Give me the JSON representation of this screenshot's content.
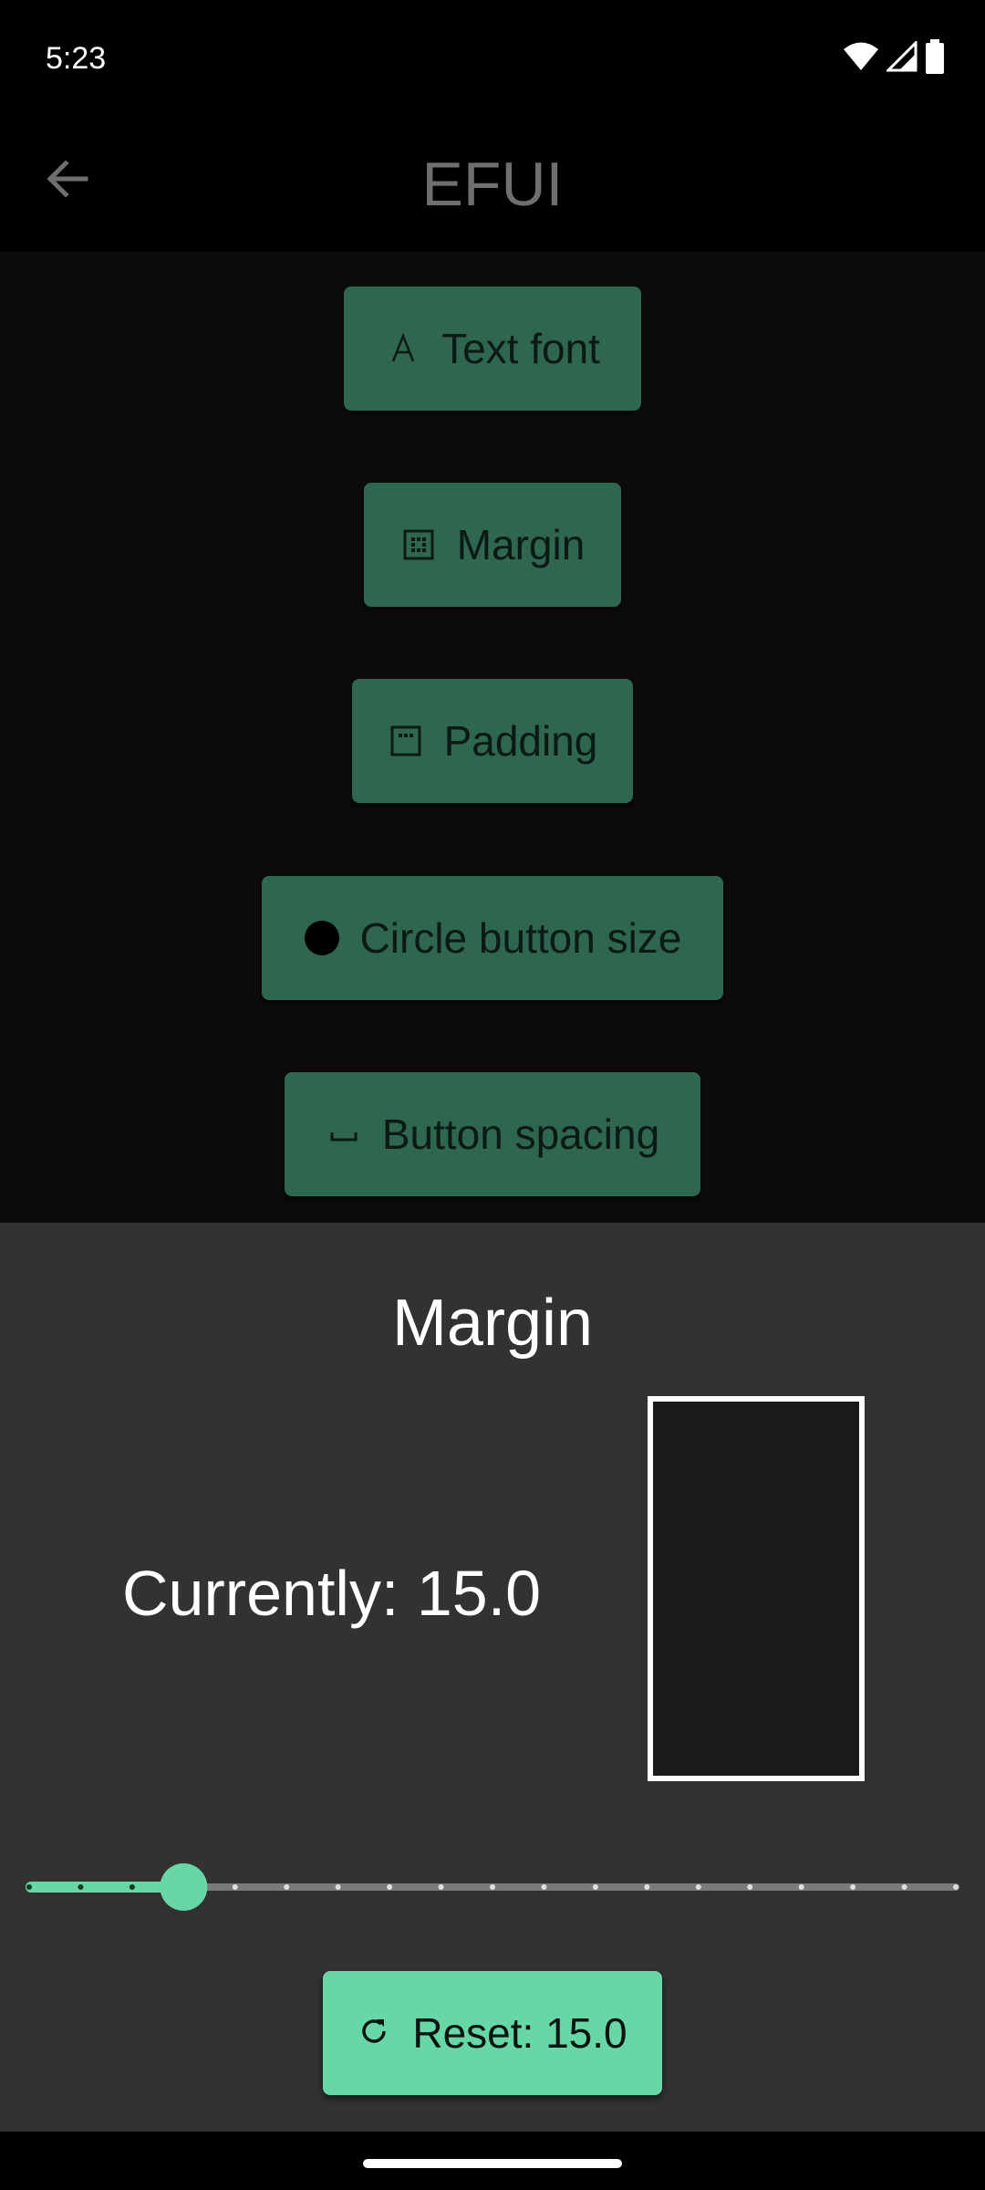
{
  "status_bar": {
    "time": "5:23",
    "icons": [
      "wifi-icon",
      "signal-icon",
      "battery-icon"
    ]
  },
  "app_bar": {
    "title": "EFUI",
    "back_icon": "arrow-left-icon"
  },
  "options": [
    {
      "label": "Text font",
      "icon": "font-icon"
    },
    {
      "label": "Margin",
      "icon": "margin-icon"
    },
    {
      "label": "Padding",
      "icon": "padding-icon"
    },
    {
      "label": "Circle button size",
      "icon": "circle-icon"
    },
    {
      "label": "Button spacing",
      "icon": "space-bar-icon"
    }
  ],
  "sheet": {
    "title": "Margin",
    "current_text": "Currently: 15.0",
    "slider": {
      "value": 15.0,
      "min": 0,
      "max": 90,
      "step": 5
    },
    "reset_label": "Reset: 15.0",
    "reset_icon": "refresh-icon"
  },
  "colors": {
    "button_bg": "#2e6650",
    "accent": "#68d6a6",
    "sheet_bg": "#323232",
    "main_bg": "#0c0c0c"
  }
}
